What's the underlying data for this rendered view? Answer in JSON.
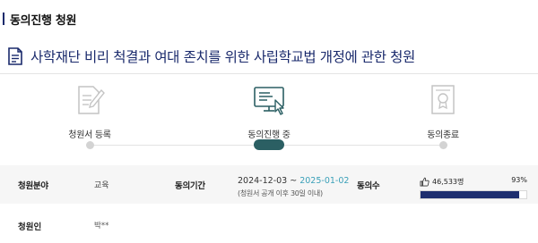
{
  "section_title": "동의진행 청원",
  "petition_title": "사학재단 비리 척결과 여대 존치를 위한 사립학교법 개정에 관한 청원",
  "steps": [
    {
      "label": "청원서 등록",
      "icon": "document-pen-icon",
      "active": false
    },
    {
      "label": "동의진행 중",
      "icon": "monitor-click-icon",
      "active": true
    },
    {
      "label": "동의종료",
      "icon": "certificate-icon",
      "active": false
    }
  ],
  "info": {
    "field_label": "청원분야",
    "field_value": "교육",
    "period_label": "동의기간",
    "period_start": "2024-12-03 ~ ",
    "period_end": "2025-01-02",
    "period_note": "(청원서 공개 이후 30일 이내)",
    "agree_label": "동의수",
    "agree_count": "46,533명",
    "agree_percent": "93%",
    "agree_fraction": 0.93
  },
  "petitioner_label": "청원인",
  "petitioner_value": "박**",
  "colors": {
    "accent": "#1a2a6c",
    "active": "#2b5f63",
    "progress": "#1e2e6e",
    "date_end": "#3aa0b8"
  }
}
